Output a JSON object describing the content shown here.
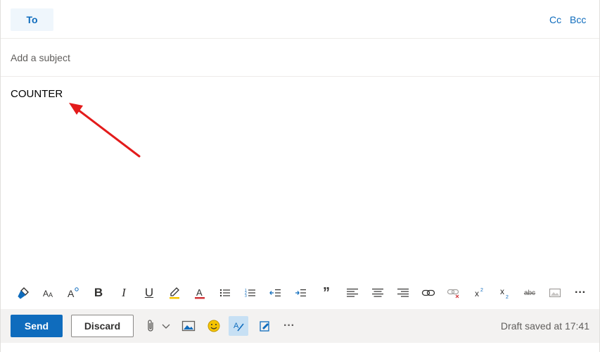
{
  "recipients": {
    "to_label": "To",
    "cc_label": "Cc",
    "bcc_label": "Bcc"
  },
  "subject": {
    "placeholder": "Add a subject",
    "value": ""
  },
  "body": {
    "text": "COUNTER"
  },
  "toolbar": {
    "items": [
      "format-painter-icon",
      "font-size-icon",
      "grow-font-icon",
      "bold-icon",
      "italic-icon",
      "underline-icon",
      "highlight-icon",
      "font-color-icon",
      "bullets-icon",
      "numbering-icon",
      "decrease-indent-icon",
      "increase-indent-icon",
      "quote-icon",
      "align-left-icon",
      "align-center-icon",
      "align-right-icon",
      "insert-link-icon",
      "remove-link-icon",
      "superscript-icon",
      "subscript-icon",
      "strikethrough-icon",
      "insert-picture-icon",
      "more-options-icon"
    ],
    "glyphs": {
      "bold": "B",
      "italic": "I",
      "underline": "U",
      "font_color": "A",
      "quote": "”",
      "more": "···",
      "strike": "abc"
    }
  },
  "actions": {
    "send_label": "Send",
    "discard_label": "Discard",
    "more": "···",
    "status": "Draft saved at 17:41"
  },
  "colors": {
    "accent": "#0f6cbd",
    "to_bg": "#eff6fc",
    "action_bar_bg": "#f3f2f1",
    "selected_bg": "#c7e0f4",
    "annotation_arrow": "#e31b1b",
    "highlight_yellow": "#f5c400",
    "font_color_red": "#d13438"
  }
}
